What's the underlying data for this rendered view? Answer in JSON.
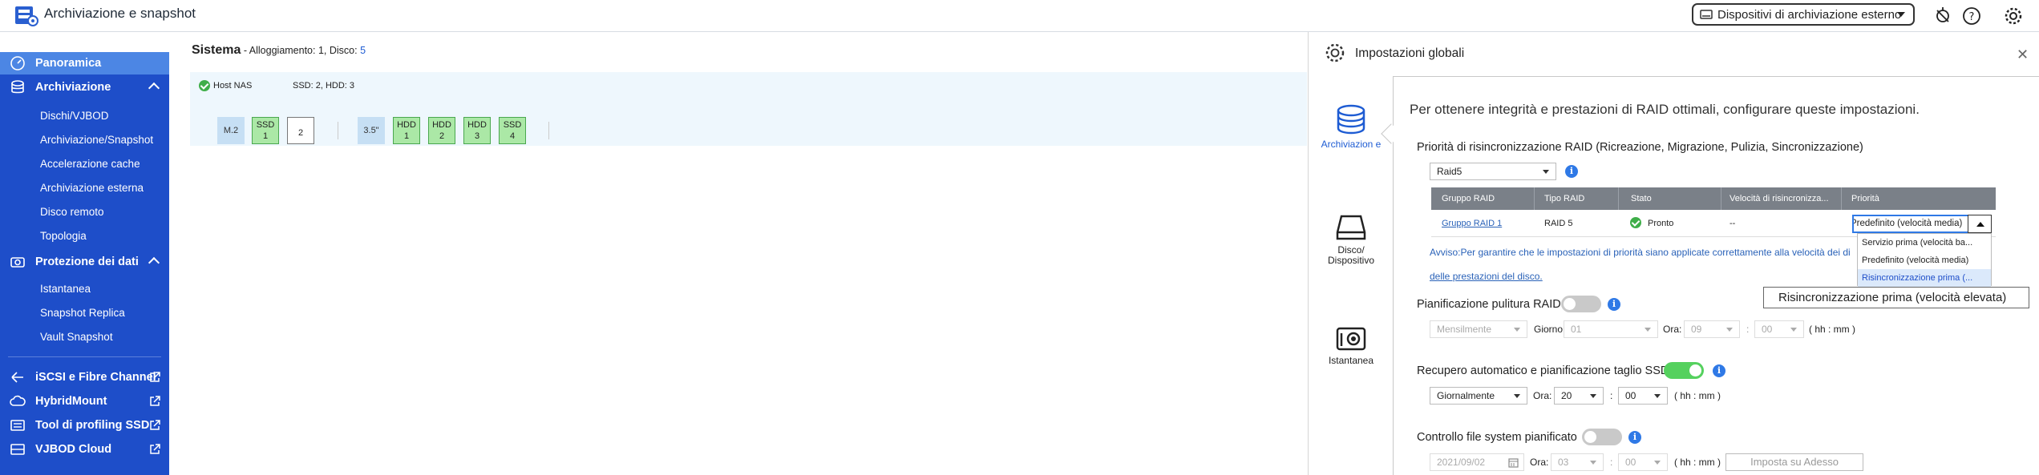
{
  "app": {
    "title": "Archiviazione e snapshot"
  },
  "header": {
    "external_devices_label": "Dispositivi di archiviazione esterno"
  },
  "sidebar": {
    "overview": "Panoramica",
    "storage": "Archiviazione",
    "storage_items": [
      "Dischi/VJBOD",
      "Archiviazione/Snapshot",
      "Accelerazione cache",
      "Archiviazione esterna",
      "Disco remoto",
      "Topologia"
    ],
    "data_protection": "Protezione dei dati",
    "protection_items": [
      "Istantanea",
      "Snapshot Replica",
      "Vault Snapshot"
    ],
    "links": [
      "iSCSI e Fibre Channel",
      "HybridMount",
      "Tool di profiling SSD",
      "VJBOD Cloud"
    ]
  },
  "main": {
    "system_label": "Sistema",
    "system_details_prefix": " - Alloggiamento: 1, Disco: ",
    "disk_count": "5",
    "host_label": "Host NAS",
    "host_disks": "SSD: 2, HDD: 3",
    "slots": {
      "m2": "M.2",
      "ssd1_type": "SSD",
      "ssd1_num": "1",
      "empty2": "2",
      "size35": "3.5\"",
      "hdd1_type": "HDD",
      "hdd1_num": "1",
      "hdd2_type": "HDD",
      "hdd2_num": "2",
      "hdd3_type": "HDD",
      "hdd3_num": "3",
      "ssd4_type": "SSD",
      "ssd4_num": "4"
    }
  },
  "panel": {
    "title": "Impostazioni globali",
    "categories": {
      "storage": "Archiviazion e",
      "disk": "Disco/ Dispositivo",
      "snapshot": "Istantanea"
    },
    "intro": "Per ottenere integrità e prestazioni di RAID ottimali, configurare queste impostazioni.",
    "resync_title": "Priorità di risincronizzazione RAID (Ricreazione, Migrazione, Pulizia, Sincronizzazione)",
    "raid_select": "Raid5",
    "table": {
      "headers": [
        "Gruppo RAID",
        "Tipo RAID",
        "Stato",
        "Velocità di risincronizza...",
        "Priorità"
      ],
      "row": {
        "group": "Gruppo RAID 1",
        "type": "RAID 5",
        "status": "Pronto",
        "speed": "--",
        "priority": "Predefinito (velocità media)"
      }
    },
    "priority_options": [
      "Servizio prima (velocità ba...",
      "Predefinito (velocità media)",
      "Risincronizzazione prima (..."
    ],
    "tooltip": "Risincronizzazione prima (velocità elevata)",
    "warning_line1": "Avviso:Per garantire che le impostazioni di priorità siano applicate correttamente alla velocità dei di",
    "warning_line2": "delle prestazioni del disco.",
    "scrub": {
      "title": "Pianificazione pulitura RAID",
      "frequency": "Mensilmente",
      "day_label": "Giorno",
      "day": "01",
      "hour_label": "Ora:",
      "hour": "09",
      "minute": "00",
      "format": "( hh : mm )"
    },
    "ssd": {
      "title": "Recupero automatico e pianificazione taglio SSD",
      "frequency": "Giornalmente",
      "hour_label": "Ora:",
      "hour": "20",
      "minute": "00",
      "format": "( hh : mm )"
    },
    "fscheck": {
      "title": "Controllo file system pianificato",
      "date": "2021/09/02",
      "hour_label": "Ora:",
      "hour": "03",
      "minute": "00",
      "format": "( hh : mm )",
      "set_now": "Imposta su Adesso"
    },
    "colon": ":"
  }
}
